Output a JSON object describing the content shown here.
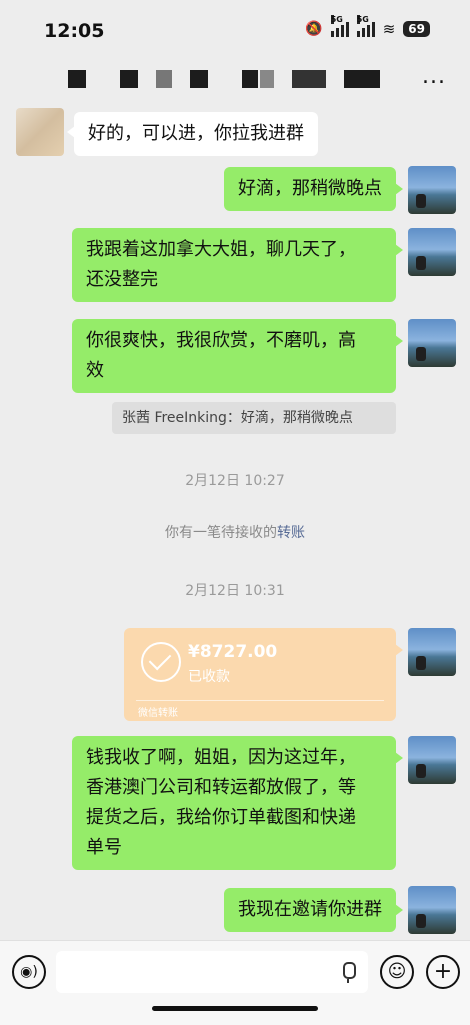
{
  "status_bar": {
    "time": "12:05",
    "net1": "5G",
    "net2": "5G",
    "battery": "69"
  },
  "header": {
    "more_label": "..."
  },
  "messages": [
    {
      "from": "other",
      "lines": [
        "好的，可以进，你拉我进群"
      ]
    },
    {
      "from": "self",
      "lines": [
        "好滴，那稍微晚点"
      ]
    },
    {
      "from": "self",
      "lines": [
        "我跟着这加拿大大姐，聊几天了，",
        "还没整完"
      ]
    },
    {
      "from": "self",
      "lines": [
        "你很爽快，我很欣赏，不磨叽，高",
        "效"
      ]
    },
    {
      "from": "self",
      "lines": [
        "钱我收了啊，姐姐，因为这过年，",
        "香港澳门公司和转运都放假了，等",
        "提货之后，我给你订单截图和快递",
        "单号"
      ]
    },
    {
      "from": "self",
      "lines": [
        "我现在邀请你进群"
      ]
    }
  ],
  "quote": "张茜 FreeInking：好滴，那稍微晚点",
  "system": {
    "time1": "2月12日 10:27",
    "pending_prefix": "你有一笔待接收的",
    "pending_link": "转账",
    "time2": "2月12日 10:31"
  },
  "transfer": {
    "amount": "¥8727.00",
    "status": "已收款",
    "footer": "微信转账"
  },
  "input_bar": {
    "voice_icon": "voice-icon",
    "emoji_icon": "emoji-icon",
    "add_icon": "add-icon"
  }
}
